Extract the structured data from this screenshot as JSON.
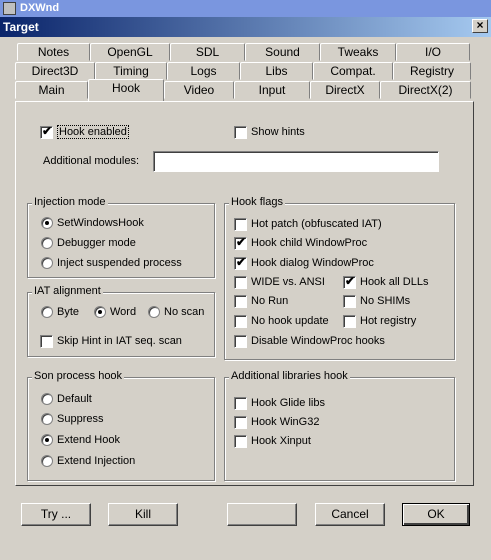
{
  "app": {
    "title": "DXWnd"
  },
  "dialog": {
    "title": "Target",
    "close_label": "×"
  },
  "tabs": {
    "row1": [
      "Notes",
      "OpenGL",
      "SDL",
      "Sound",
      "Tweaks",
      "I/O"
    ],
    "row2": [
      "Direct3D",
      "Timing",
      "Logs",
      "Libs",
      "Compat.",
      "Registry"
    ],
    "row3": [
      "Main",
      "Hook",
      "Video",
      "Input",
      "DirectX",
      "DirectX(2)"
    ],
    "active": "Hook"
  },
  "hook_enabled": {
    "label": "Hook enabled",
    "checked": true
  },
  "show_hints": {
    "label": "Show hints",
    "checked": false
  },
  "additional_modules": {
    "label": "Additional modules:",
    "value": ""
  },
  "injection_mode": {
    "title": "Injection mode",
    "options": [
      {
        "label": "SetWindowsHook",
        "selected": true
      },
      {
        "label": "Debugger mode",
        "selected": false
      },
      {
        "label": "Inject suspended process",
        "selected": false
      }
    ]
  },
  "iat_alignment": {
    "title": "IAT alignment",
    "options": [
      {
        "label": "Byte",
        "selected": false
      },
      {
        "label": "Word",
        "selected": true
      },
      {
        "label": "No scan",
        "selected": false
      }
    ],
    "skip_hint": {
      "label": "Skip Hint in IAT seq. scan",
      "checked": false
    }
  },
  "son_process_hook": {
    "title": "Son process hook",
    "options": [
      {
        "label": "Default",
        "selected": false
      },
      {
        "label": "Suppress",
        "selected": false
      },
      {
        "label": "Extend Hook",
        "selected": true
      },
      {
        "label": "Extend Injection",
        "selected": false
      }
    ]
  },
  "hook_flags": {
    "title": "Hook flags",
    "hot_patch": {
      "label": "Hot patch (obfuscated IAT)",
      "checked": false
    },
    "hook_child": {
      "label": "Hook child WindowProc",
      "checked": true
    },
    "hook_dialog": {
      "label": "Hook dialog WindowProc",
      "checked": true
    },
    "wide_ansi": {
      "label": "WIDE vs. ANSI",
      "checked": false
    },
    "hook_all_dlls": {
      "label": "Hook all DLLs",
      "checked": true
    },
    "no_run": {
      "label": "No Run",
      "checked": false
    },
    "no_shims": {
      "label": "No SHIMs",
      "checked": false
    },
    "no_hook_update": {
      "label": "No hook update",
      "checked": false
    },
    "hot_registry": {
      "label": "Hot registry",
      "checked": false
    },
    "disable_windowproc": {
      "label": "Disable WindowProc hooks",
      "checked": false
    }
  },
  "additional_libraries": {
    "title": "Additional libraries hook",
    "items": [
      {
        "label": "Hook Glide libs",
        "checked": false
      },
      {
        "label": "Hook WinG32",
        "checked": false
      },
      {
        "label": "Hook Xinput",
        "checked": false
      }
    ]
  },
  "buttons": {
    "try": "Try ...",
    "kill": "Kill",
    "blank": "",
    "cancel": "Cancel",
    "ok": "OK"
  },
  "check_glyph": "✔"
}
